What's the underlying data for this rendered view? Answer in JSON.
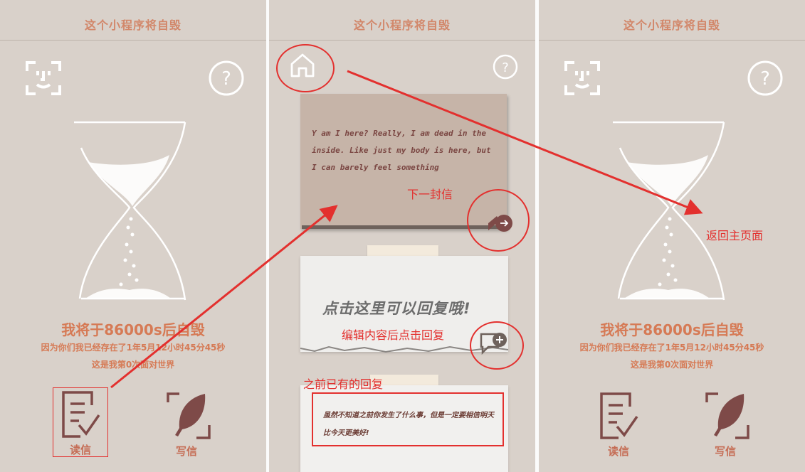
{
  "panels": [
    {
      "title": "这个小程序将自毁",
      "status_main": "我将于86000s后自毁",
      "status_line1": "因为你们我已经存在了1年5月12小时45分45秒",
      "status_line2": "这是我第0次面对世界",
      "nav_read": "读信",
      "nav_write": "写信"
    },
    {
      "title": "这个小程序将自毁",
      "letter_text": "Y am I here? Really, I am dead in the inside. Like just my body is here, but I can barely feel something",
      "reply_prompt": "点击这里可以回复哦!",
      "previous_reply": "虽然不知道之前你发生了什么事，但是一定要相信明天比今天更美好!"
    },
    {
      "title": "这个小程序将自毁",
      "status_main": "我将于86000s后自毁",
      "status_line1": "因为你们我已经存在了1年5月12小时45分45秒",
      "status_line2": "这是我第0次面对世界",
      "nav_read": "读信",
      "nav_write": "写信"
    }
  ],
  "annotations": {
    "next_letter": "下一封信",
    "edit_then_reply": "编辑内容后点击回复",
    "existing_reply": "之前已有的回复",
    "back_home": "返回主页面"
  },
  "icons": {
    "face_scan": "face-scan-icon",
    "help": "question-icon",
    "home": "home-icon",
    "hourglass": "hourglass-icon",
    "next": "next-letter-icon",
    "reply": "reply-add-icon",
    "read": "read-letter-icon",
    "write": "quill-icon"
  },
  "colors": {
    "background": "#d9d1ca",
    "accent": "#d67a55",
    "dark_accent": "#7e4a48",
    "annotation": "#e3302e"
  }
}
